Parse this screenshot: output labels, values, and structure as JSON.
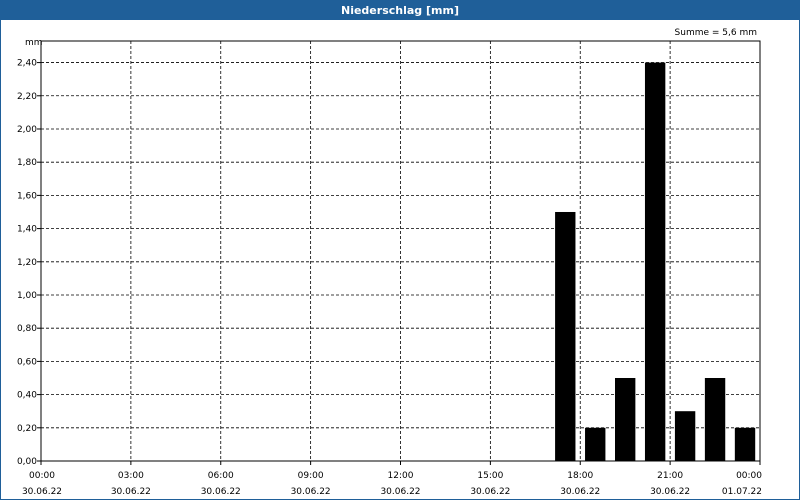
{
  "window": {
    "title": "Niederschlag [mm]"
  },
  "chart_data": {
    "type": "bar",
    "title": "Niederschlag [mm]",
    "ylabel": "mm",
    "annotation": "Summe = 5,6 mm",
    "ylim": [
      0,
      2.53
    ],
    "xlim_hours": [
      0,
      24
    ],
    "y_ticks": [
      "0,00",
      "0,20",
      "0,40",
      "0,60",
      "0,80",
      "1,00",
      "1,20",
      "1,40",
      "1,60",
      "1,80",
      "2,00",
      "2,20",
      "2,40"
    ],
    "y_tick_values": [
      0,
      0.2,
      0.4,
      0.6,
      0.8,
      1.0,
      1.2,
      1.4,
      1.6,
      1.8,
      2.0,
      2.2,
      2.4
    ],
    "x_ticks": [
      {
        "time": "00:00",
        "date": "30.06.22",
        "hour": 0
      },
      {
        "time": "03:00",
        "date": "30.06.22",
        "hour": 3
      },
      {
        "time": "06:00",
        "date": "30.06.22",
        "hour": 6
      },
      {
        "time": "09:00",
        "date": "30.06.22",
        "hour": 9
      },
      {
        "time": "12:00",
        "date": "30.06.22",
        "hour": 12
      },
      {
        "time": "15:00",
        "date": "30.06.22",
        "hour": 15
      },
      {
        "time": "18:00",
        "date": "30.06.22",
        "hour": 18
      },
      {
        "time": "21:00",
        "date": "30.06.22",
        "hour": 21
      },
      {
        "time": "00:00",
        "date": "01.07.22",
        "hour": 24
      }
    ],
    "grid": true,
    "bar_color": "#000000",
    "bars": [
      {
        "hour": 17.5,
        "value": 1.5
      },
      {
        "hour": 18.5,
        "value": 0.2
      },
      {
        "hour": 19.5,
        "value": 0.5
      },
      {
        "hour": 20.5,
        "value": 2.4
      },
      {
        "hour": 21.5,
        "value": 0.3
      },
      {
        "hour": 22.5,
        "value": 0.5
      },
      {
        "hour": 23.5,
        "value": 0.2
      }
    ]
  }
}
